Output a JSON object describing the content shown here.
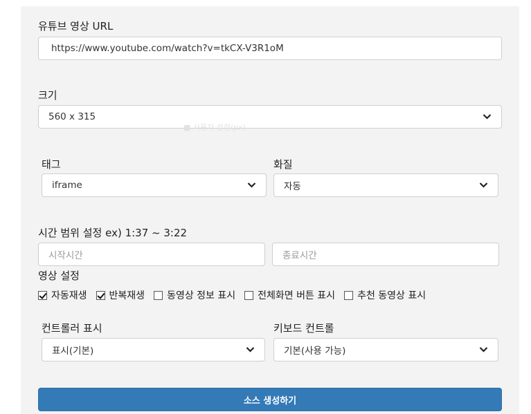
{
  "url_section": {
    "label": "유튜브 영상 URL",
    "value": "https://www.youtube.com/watch?v=tkCX-V3R1oM"
  },
  "size_section": {
    "label": "크기",
    "selected": "560 x 315",
    "ghost_text": "■    사용자 설정(px)"
  },
  "tag_section": {
    "label": "태그",
    "selected": "iframe"
  },
  "quality_section": {
    "label": "화질",
    "selected": "자동"
  },
  "time_section": {
    "label": "시간 범위 설정 ex) 1:37  ~  3:22",
    "start_placeholder": "시작시간",
    "end_placeholder": "종료시간"
  },
  "video_settings": {
    "label": "영상 설정",
    "options": [
      {
        "label": "자동재생",
        "checked": true
      },
      {
        "label": "반복재생",
        "checked": true
      },
      {
        "label": "동영상 정보 표시",
        "checked": false
      },
      {
        "label": "전체화면 버튼 표시",
        "checked": false
      },
      {
        "label": "추천 동영상 표시",
        "checked": false
      }
    ]
  },
  "controls_section": {
    "label": "컨트롤러 표시",
    "selected": "표시(기본)"
  },
  "keyboard_section": {
    "label": "키보드 컨트롤",
    "selected": "기본(사용 가능)"
  },
  "generate_button": {
    "label": "소스 생성하기"
  },
  "colors": {
    "primary": "#337ab7",
    "panel": "#f3f3f3"
  }
}
